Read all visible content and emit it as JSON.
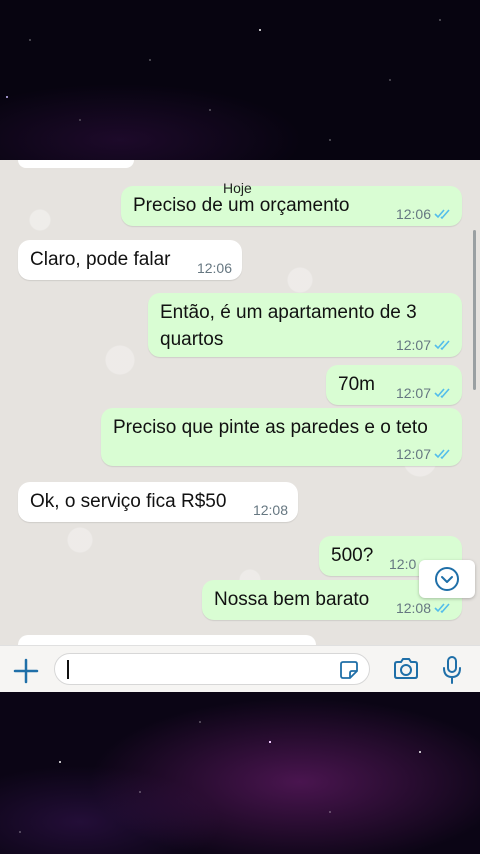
{
  "chat": {
    "date_label": "Hoje",
    "messages": [
      {
        "direction": "out",
        "text": "Preciso de um orçamento",
        "time": "12:06",
        "status": "read"
      },
      {
        "direction": "in",
        "text": "Claro, pode falar",
        "time": "12:06"
      },
      {
        "direction": "out",
        "text": "Então, é um apartamento de 3 quartos",
        "time": "12:07",
        "status": "read"
      },
      {
        "direction": "out",
        "text": "70m",
        "time": "12:07",
        "status": "read"
      },
      {
        "direction": "out",
        "text": "Preciso que pinte as paredes e o teto",
        "time": "12:07",
        "status": "read"
      },
      {
        "direction": "in",
        "text": "Ok, o serviço fica R$50",
        "time": "12:08"
      },
      {
        "direction": "out",
        "text": "500?",
        "time": "12:0",
        "status": "read"
      },
      {
        "direction": "out",
        "text": "Nossa bem barato",
        "time": "12:08",
        "status": "read"
      }
    ]
  },
  "composer": {
    "placeholder": "",
    "icons": {
      "attach": "plus-icon",
      "sticker": "sticker-icon",
      "camera": "camera-icon",
      "mic": "microphone-icon",
      "scroll": "chevron-down-icon"
    }
  },
  "colors": {
    "outgoing_bubble": "#d9fdd3",
    "incoming_bubble": "#ffffff",
    "accent": "#1f6fa8",
    "read_ticks": "#53bdeb",
    "chat_background": "#e6e3df"
  }
}
